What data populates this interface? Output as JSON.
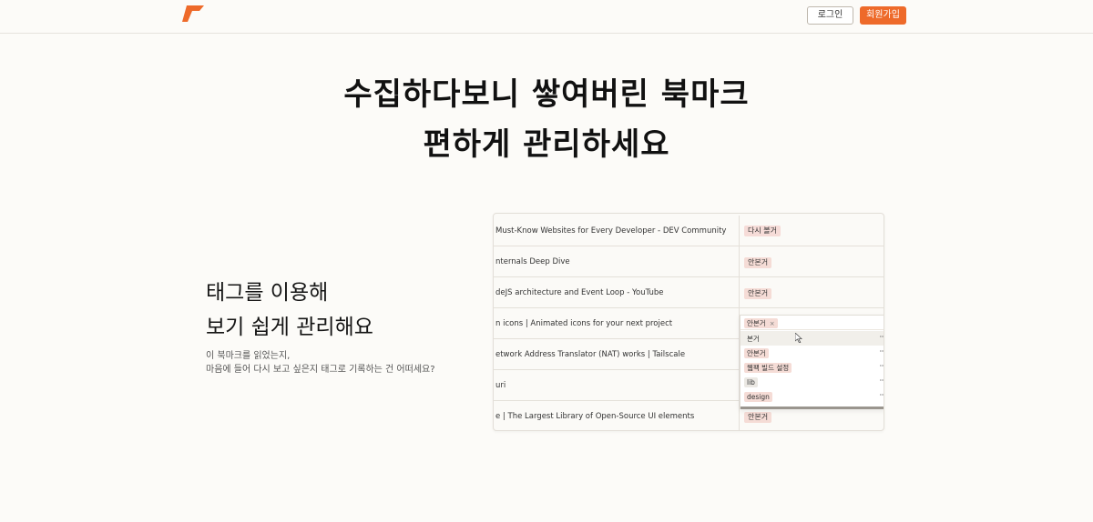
{
  "header": {
    "login_label": "로그인",
    "signup_label": "회원가입",
    "brand_color": "#ee6a2a"
  },
  "hero": {
    "line1": "수집하다보니 쌓여버린 북마크",
    "line2": "편하게 관리하세요"
  },
  "feature": {
    "title_line1": "태그를 이용해",
    "title_line2": "보기 쉽게 관리해요",
    "desc_line1": "이 북마크를 읽었는지,",
    "desc_line2": "마음에 들어 다시 보고 싶은지 태그로 기록하는 건 어떠세요?"
  },
  "bookmarks": [
    {
      "title": "Must-Know Websites for Every Developer - DEV Community",
      "tag": "다시 볼거"
    },
    {
      "title": "nternals Deep Dive",
      "tag": "안본거"
    },
    {
      "title": "deJS architecture and Event Loop - YouTube",
      "tag": "안본거"
    },
    {
      "title": "n icons | Animated icons for your next project",
      "tag": ""
    },
    {
      "title": "etwork Address Translator (NAT) works | Tailscale",
      "tag": ""
    },
    {
      "title": "uri",
      "tag": ""
    },
    {
      "title": "e | The Largest Library of Open-Source UI elements",
      "tag": "안본거"
    }
  ],
  "tag_dropdown": {
    "selected_chip": "안본거",
    "chip_remove": "×",
    "options": [
      {
        "label": "본거",
        "color": "#ffffff"
      },
      {
        "label": "안본거",
        "color": "#f5dcd6"
      },
      {
        "label": "웹팩 빌드 설정",
        "color": "#f5dcd6"
      },
      {
        "label": "lib",
        "color": "#ebe8e3"
      },
      {
        "label": "design",
        "color": "#f5dcd6"
      }
    ],
    "more_icon": "···"
  }
}
